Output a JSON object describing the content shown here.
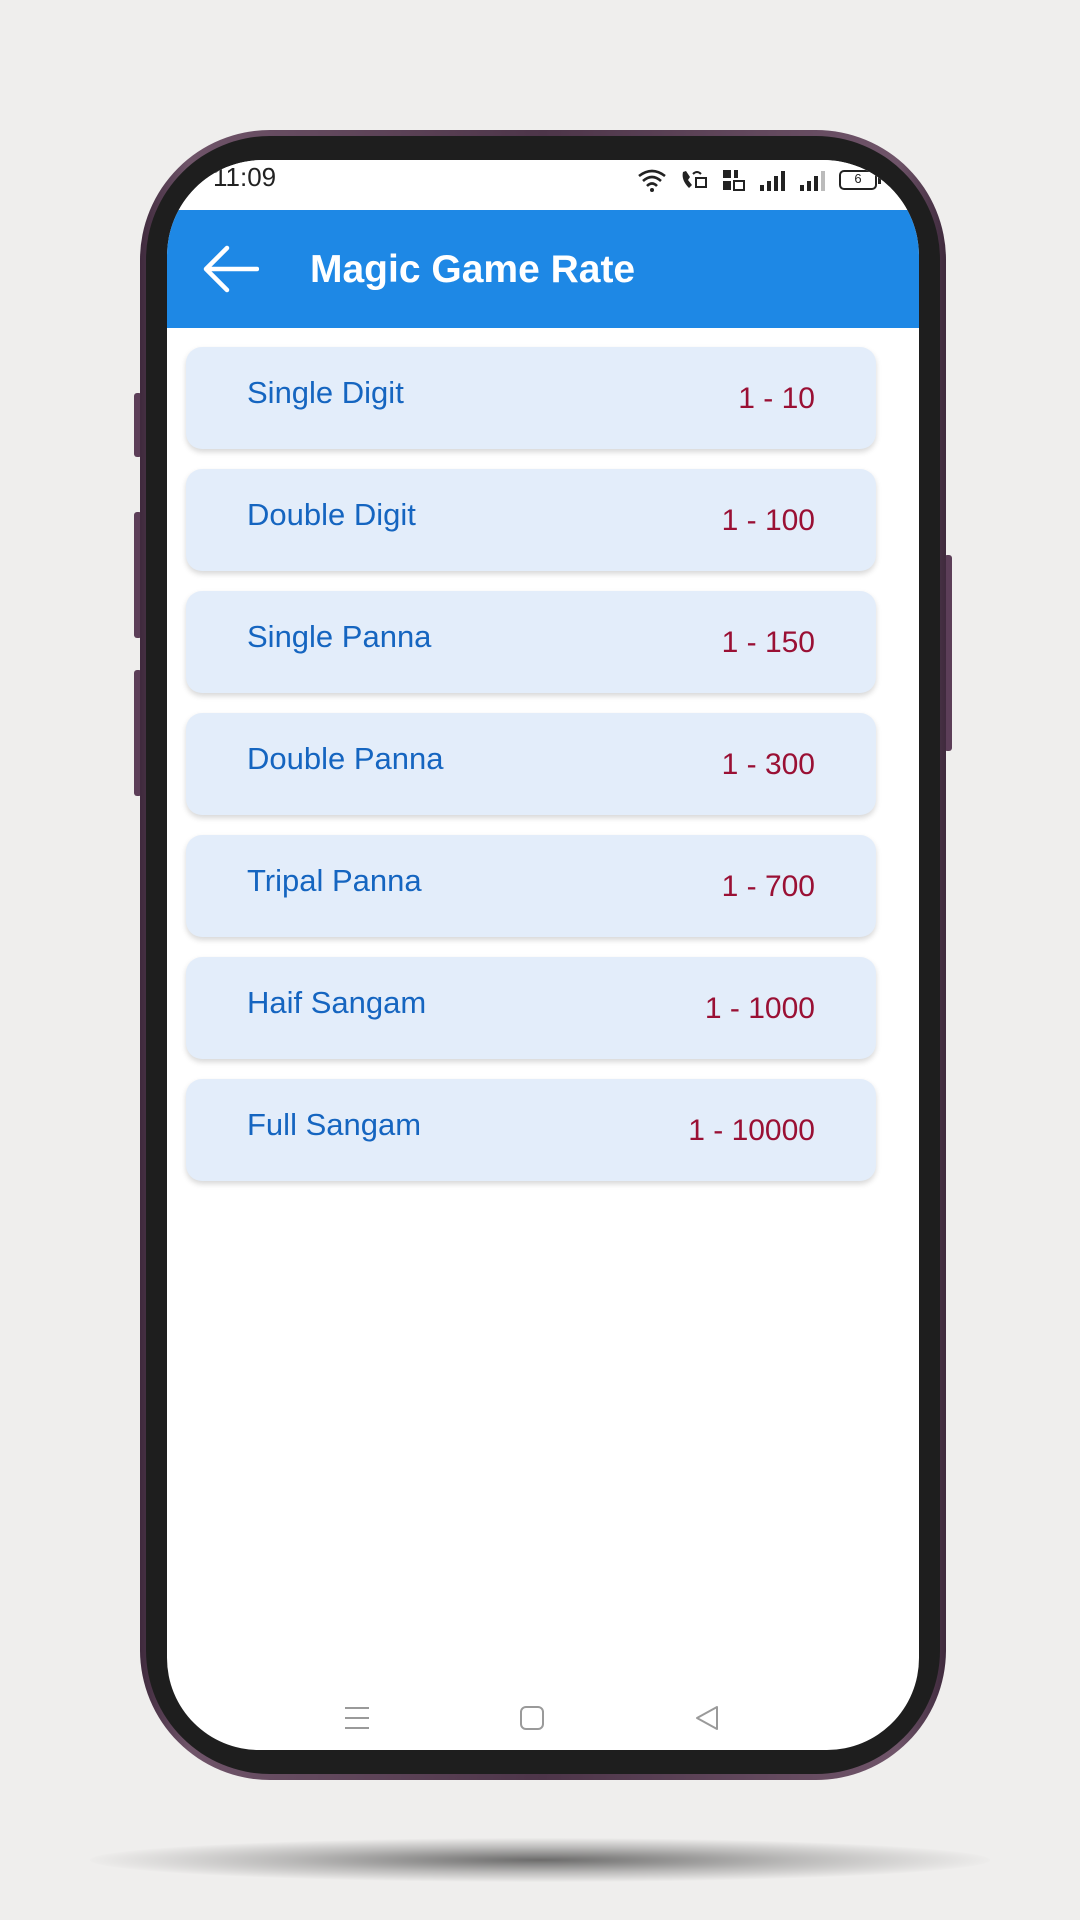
{
  "status_bar": {
    "time": "11:09",
    "battery": "6"
  },
  "app_bar": {
    "title": "Magic Game Rate",
    "back_icon": "arrow-left-icon"
  },
  "rates": [
    {
      "name": "Single Digit",
      "value": "1 - 10"
    },
    {
      "name": "Double Digit",
      "value": "1 - 100"
    },
    {
      "name": "Single Panna",
      "value": "1 - 150"
    },
    {
      "name": "Double Panna",
      "value": "1 - 300"
    },
    {
      "name": "Tripal Panna",
      "value": "1 - 700"
    },
    {
      "name": "Haif Sangam",
      "value": "1 - 1000"
    },
    {
      "name": "Full Sangam",
      "value": "1 - 10000"
    }
  ],
  "nav_bar": {
    "icons": [
      "menu-icon",
      "home-icon",
      "back-triangle-icon"
    ]
  },
  "colors": {
    "app_bar": "#1e88e5",
    "card_background": "#e3edfa",
    "rate_name": "#1565c0",
    "rate_value": "#9a1034"
  }
}
